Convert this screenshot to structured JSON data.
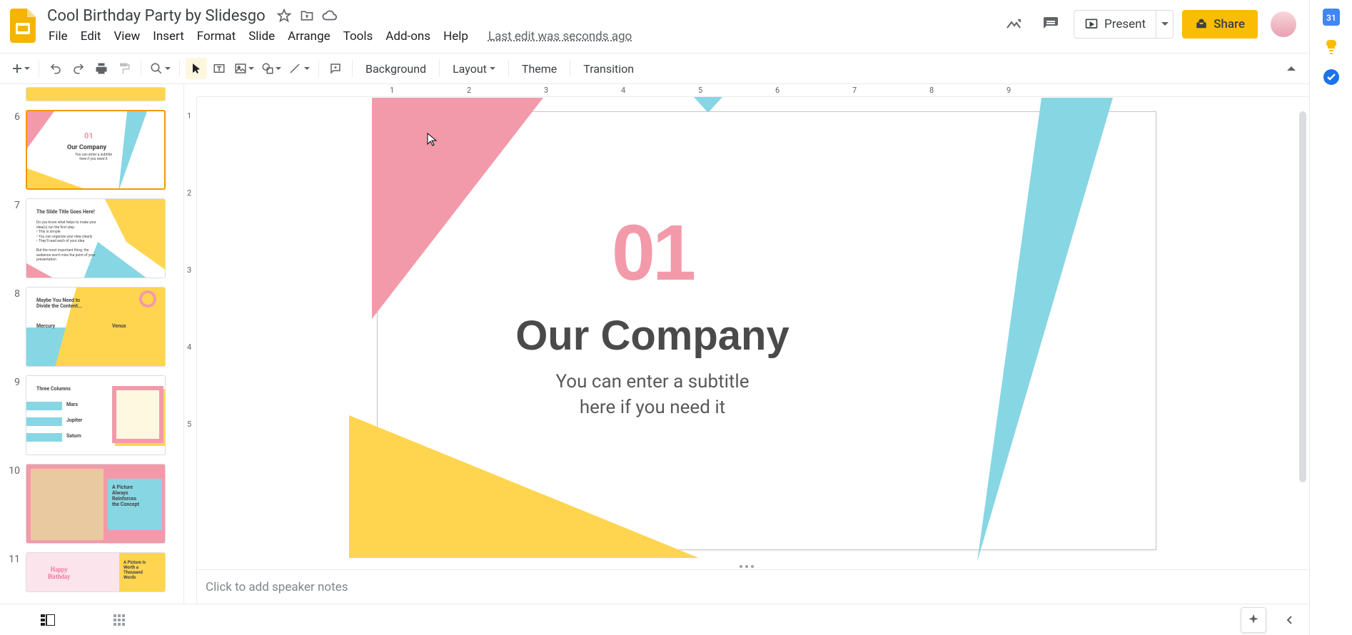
{
  "doc": {
    "title": "Cool Birthday Party by Slidesgo",
    "last_edit": "Last edit was seconds ago"
  },
  "menu": {
    "file": "File",
    "edit": "Edit",
    "view": "View",
    "insert": "Insert",
    "format": "Format",
    "slide": "Slide",
    "arrange": "Arrange",
    "tools": "Tools",
    "addons": "Add-ons",
    "help": "Help"
  },
  "actions": {
    "present": "Present",
    "share": "Share"
  },
  "toolbar": {
    "background": "Background",
    "layout": "Layout",
    "theme": "Theme",
    "transition": "Transition"
  },
  "ruler_h": [
    "1",
    "2",
    "3",
    "4",
    "5",
    "6",
    "7",
    "8",
    "9"
  ],
  "ruler_v": [
    "1",
    "2",
    "3",
    "4",
    "5"
  ],
  "slide": {
    "num": "01",
    "title": "Our Company",
    "subtitle1": "You can enter a subtitle",
    "subtitle2": "here if you need it"
  },
  "notes": {
    "placeholder": "Click to add speaker notes"
  },
  "thumbs": [
    {
      "n": "6",
      "selected": true,
      "title": "Our Company",
      "num": "01",
      "sub": "You can enter a subtitle\nhere if you need it"
    },
    {
      "n": "7",
      "selected": false,
      "title": "The Slide Title Goes Here!"
    },
    {
      "n": "8",
      "selected": false,
      "title": "Maybe You Need to\nDivide the Content...",
      "l": "Mercury",
      "r": "Venus"
    },
    {
      "n": "9",
      "selected": false,
      "title": "Three Columns",
      "a": "Mars",
      "b": "Jupiter",
      "c": "Saturn"
    },
    {
      "n": "10",
      "selected": false,
      "title": "A Picture\nAlways\nReinforces\nthe Concept"
    },
    {
      "n": "11",
      "selected": false,
      "title": "A Picture Is\nWorth a\nThousand\nWords",
      "hb": "Happy\nBirthday"
    }
  ]
}
